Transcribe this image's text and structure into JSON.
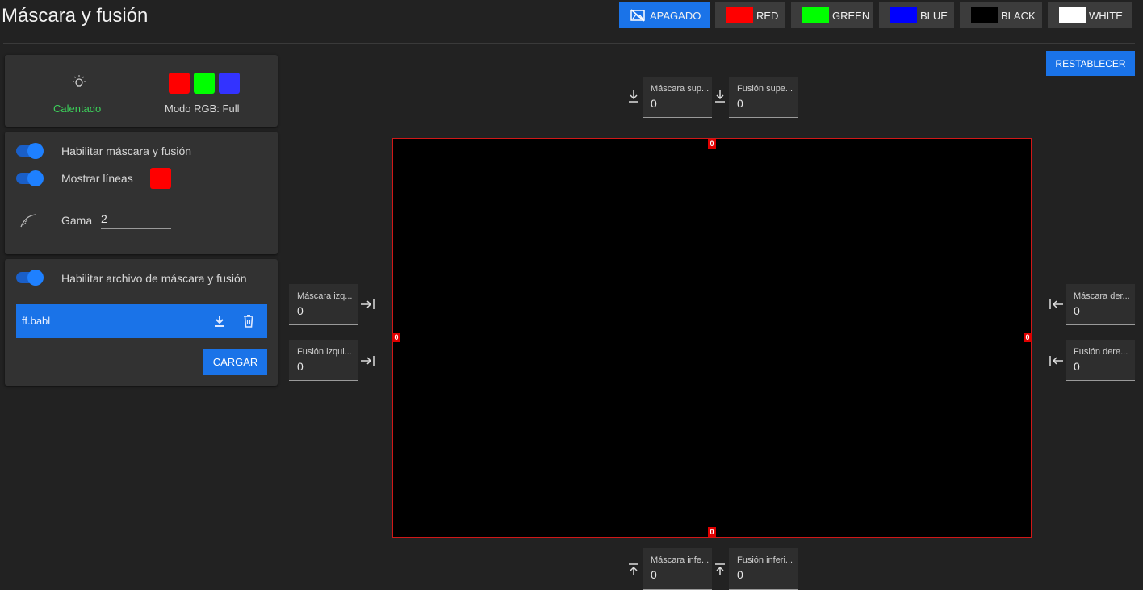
{
  "header": {
    "title": "Máscara y fusión",
    "patterns": [
      {
        "label": "APAGADO",
        "color": "",
        "icon": "no-image-icon",
        "active": true
      },
      {
        "label": "RED",
        "color": "#ff0000"
      },
      {
        "label": "GREEN",
        "color": "#00ff00"
      },
      {
        "label": "BLUE",
        "color": "#0000ff"
      },
      {
        "label": "BLACK",
        "color": "#000000"
      },
      {
        "label": "WHITE",
        "color": "#ffffff"
      }
    ]
  },
  "reset_label": "RESTABLECER",
  "status": {
    "lamp_label": "Calentado",
    "rgb_mode_label": "Modo RGB: Full",
    "rgb_colors": [
      "#ff0000",
      "#00ff00",
      "#3333ff"
    ]
  },
  "settings": {
    "enable_label": "Habilitar máscara y fusión",
    "lines_label": "Mostrar líneas",
    "line_color": "#ff0000",
    "gamma_label": "Gama",
    "gamma_value": "2"
  },
  "file": {
    "enable_label": "Habilitar archivo de máscara y fusión",
    "filename": "ff.babl",
    "load_label": "CARGAR"
  },
  "fields": {
    "mask_top": {
      "label": "Máscara sup...",
      "value": "0"
    },
    "blend_top": {
      "label": "Fusión supe...",
      "value": "0"
    },
    "mask_left": {
      "label": "Máscara izq...",
      "value": "0"
    },
    "blend_left": {
      "label": "Fusión izqui...",
      "value": "0"
    },
    "mask_right": {
      "label": "Máscara der...",
      "value": "0"
    },
    "blend_right": {
      "label": "Fusión dere...",
      "value": "0"
    },
    "mask_bottom": {
      "label": "Máscara infe...",
      "value": "0"
    },
    "blend_bottom": {
      "label": "Fusión inferi...",
      "value": "0"
    }
  },
  "markers": {
    "top": "0",
    "bottom": "0",
    "left": "0",
    "right": "0"
  }
}
